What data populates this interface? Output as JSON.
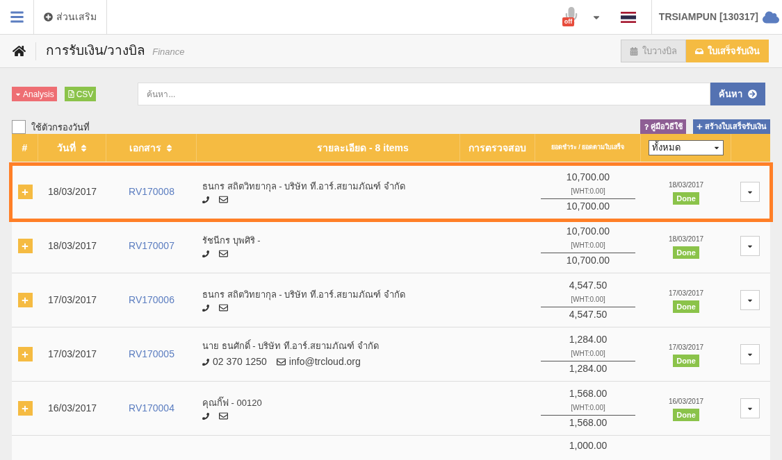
{
  "topbar": {
    "addons_label": "ส่วนเสริม",
    "mic_badge": "off",
    "user": "TRSIAMPUN [130317]"
  },
  "header": {
    "title": "การรับเงิน/วางบิล",
    "subtitle": "Finance",
    "tabs": [
      {
        "label": "ใบวางบิล",
        "selected": false
      },
      {
        "label": "ใบเสร็จรับเงิน",
        "selected": true
      }
    ]
  },
  "toolbar": {
    "analysis": "Analysis",
    "csv": "CSV",
    "search": {
      "placeholder": "ค้นหา..."
    },
    "search_button": "ค้นหา",
    "date_filter": {
      "label": "ใช้ตัวกรองวันที่",
      "checked": false
    },
    "help": "คู่มือวิธีใช้",
    "create": "สร้างใบเสร็จรับเงิน"
  },
  "table": {
    "columns": [
      "#",
      "วันที่",
      "เอกสาร",
      "รายละเอียด - 8 items",
      "การตรวจสอบ",
      "ยอดชำระ / ยอดตามใบเสร็จ"
    ],
    "status_filter": "ทั้งหมด",
    "rows": [
      {
        "highlighted": true,
        "date": "18/03/2017",
        "doc": "RV170008",
        "name": "ธนกร สถิตวิทยากุล - บริษัท ที.อาร์.สยามภัณฑ์ จำกัด",
        "phone": "",
        "email": "",
        "amount": "10,700.00",
        "wht": "[WHT:0.00]",
        "total": "10,700.00",
        "status_date": "18/03/2017",
        "status": "Done"
      },
      {
        "highlighted": false,
        "date": "18/03/2017",
        "doc": "RV170007",
        "name": "รัชนีกร บุพศิริ -",
        "phone": "",
        "email": "",
        "amount": "10,700.00",
        "wht": "[WHT:0.00]",
        "total": "10,700.00",
        "status_date": "18/03/2017",
        "status": "Done"
      },
      {
        "highlighted": false,
        "date": "17/03/2017",
        "doc": "RV170006",
        "name": "ธนกร สถิตวิทยากุล - บริษัท ที.อาร์.สยามภัณฑ์ จำกัด",
        "phone": "",
        "email": "",
        "amount": "4,547.50",
        "wht": "[WHT:0.00]",
        "total": "4,547.50",
        "status_date": "17/03/2017",
        "status": "Done"
      },
      {
        "highlighted": false,
        "date": "17/03/2017",
        "doc": "RV170005",
        "name": "นาย ธนศักดิ์ - บริษัท ที.อาร์.สยามภัณฑ์ จำกัด",
        "phone": "02 370 1250",
        "email": "info@trcloud.org",
        "amount": "1,284.00",
        "wht": "[WHT:0.00]",
        "total": "1,284.00",
        "status_date": "17/03/2017",
        "status": "Done"
      },
      {
        "highlighted": false,
        "date": "16/03/2017",
        "doc": "RV170004",
        "name": "คุณกิ๊ฟ - 00120",
        "phone": "",
        "email": "",
        "amount": "1,568.00",
        "wht": "[WHT:0.00]",
        "total": "1,568.00",
        "status_date": "16/03/2017",
        "status": "Done"
      }
    ],
    "partial_row": {
      "amount": "1,000.00"
    }
  }
}
